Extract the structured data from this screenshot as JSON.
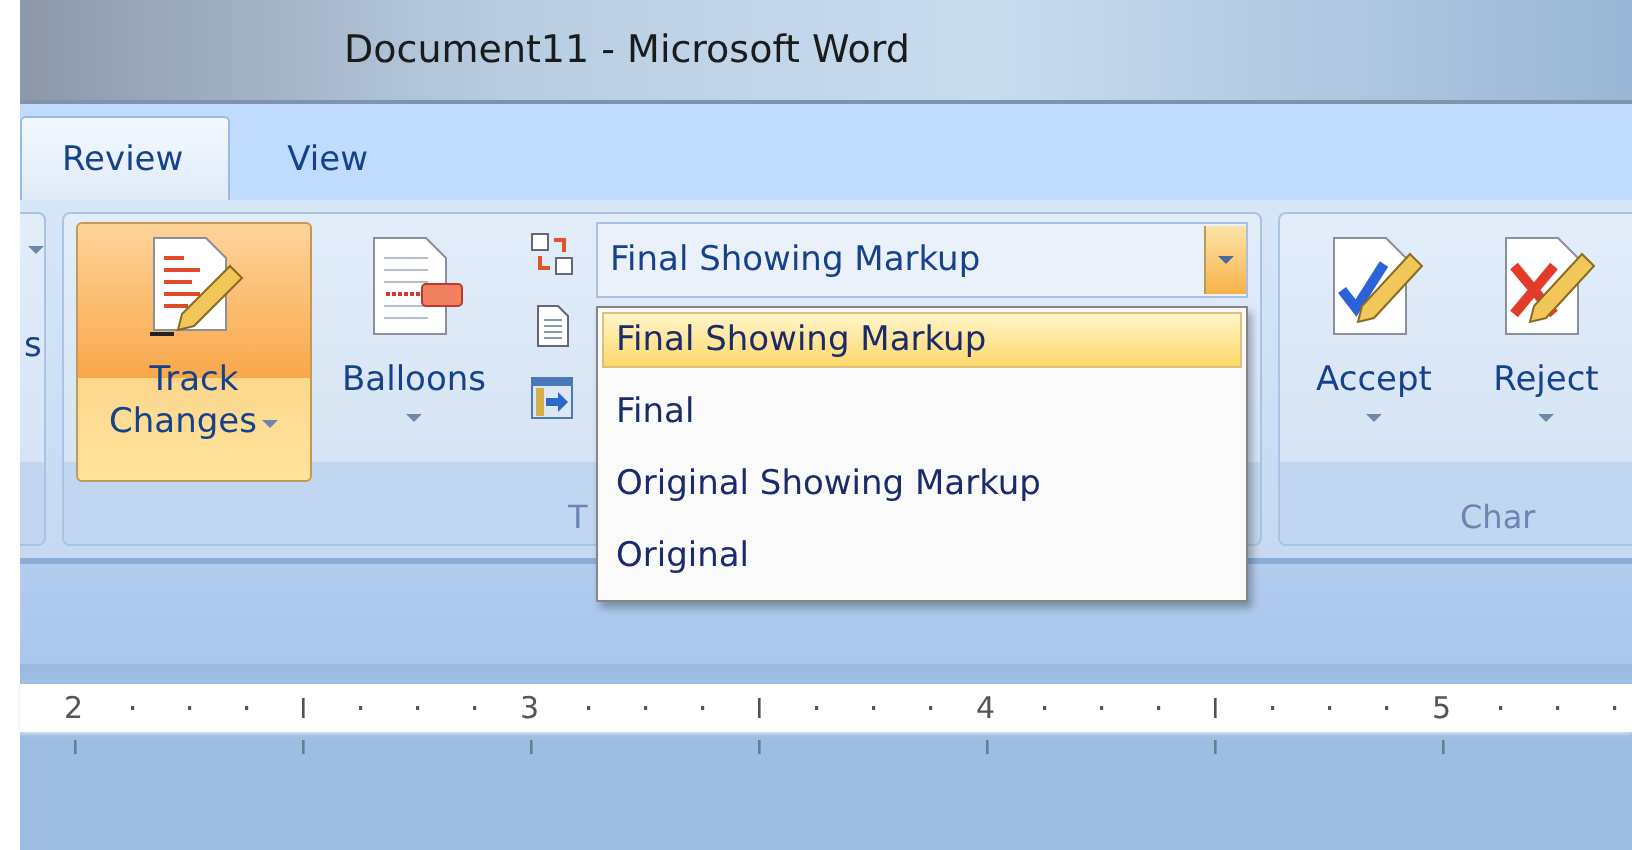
{
  "window": {
    "title": "Document11 - Microsoft Word"
  },
  "tabs": [
    {
      "label": "Review",
      "selected": true
    },
    {
      "label": "View",
      "selected": false
    }
  ],
  "ribbon": {
    "left_group": {
      "button_label": "s"
    },
    "tracking_group": {
      "label": "T",
      "buttons": [
        {
          "kind": "track",
          "lines": [
            "Track",
            "Changes"
          ],
          "active": true
        },
        {
          "kind": "balloons",
          "lines": [
            "Balloons"
          ],
          "active": false
        }
      ],
      "display": {
        "value": "Final Showing Markup",
        "expanded": true,
        "items": [
          {
            "label": "Final Showing Markup",
            "selected": true
          },
          {
            "label": "Final",
            "selected": false
          },
          {
            "label": "Original Showing Markup",
            "selected": false
          },
          {
            "label": "Original",
            "selected": false
          }
        ]
      }
    },
    "changes_group": {
      "label": "Char",
      "buttons": [
        {
          "kind": "accept",
          "label": "Accept"
        },
        {
          "kind": "reject",
          "label": "Reject"
        }
      ]
    }
  },
  "ruler": {
    "numbers": [
      "2",
      "3",
      "4",
      "5"
    ]
  }
}
